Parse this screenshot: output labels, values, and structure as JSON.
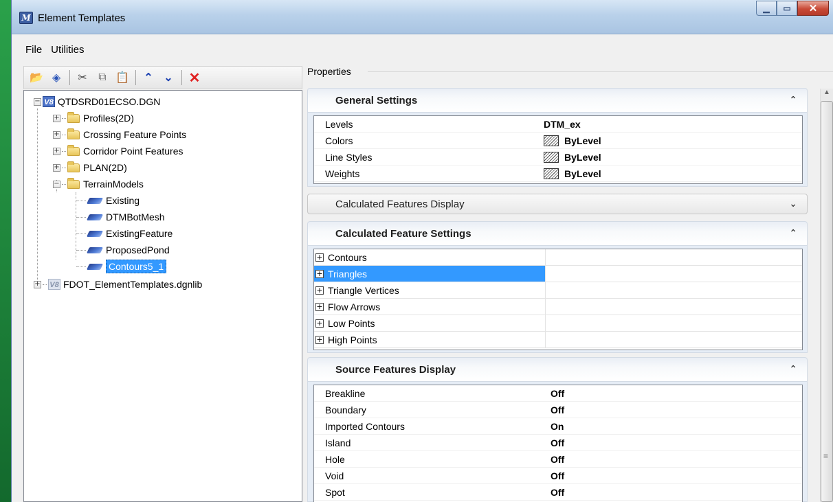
{
  "window": {
    "title": "Element Templates",
    "app_icon": "microstation-icon",
    "controls": {
      "minimize": "minimize-icon",
      "maximize": "maximize-icon",
      "close": "close-icon"
    }
  },
  "menu": [
    "File",
    "Utilities"
  ],
  "toolbar": {
    "buttons": [
      "open-folder-icon",
      "new-template-icon",
      "cut-icon",
      "copy-icon",
      "paste-icon",
      "move-up-icon",
      "move-down-icon",
      "delete-icon"
    ]
  },
  "tree": {
    "root": "QTDSRD01ECSO.DGN",
    "folders": [
      "Profiles(2D)",
      "Crossing Feature Points",
      "Corridor Point Features",
      "PLAN(2D)",
      "TerrainModels"
    ],
    "terrain_items": [
      "Existing",
      "DTMBotMesh",
      "ExistingFeature",
      "ProposedPond",
      "Contours5_1"
    ],
    "selected": "Contours5_1",
    "library": "FDOT_ElementTemplates.dgnlib"
  },
  "properties": {
    "label": "Properties",
    "general": {
      "title": "General Settings",
      "rows": [
        {
          "label": "Levels",
          "value": "DTM_ex"
        },
        {
          "label": "Colors",
          "value": "ByLevel"
        },
        {
          "label": "Line Styles",
          "value": "ByLevel"
        },
        {
          "label": "Weights",
          "value": "ByLevel"
        }
      ]
    },
    "calc_display": {
      "title": "Calculated Features Display"
    },
    "calc_settings": {
      "title": "Calculated Feature Settings",
      "rows": [
        "Contours",
        "Triangles",
        "Triangle Vertices",
        "Flow Arrows",
        "Low Points",
        "High Points"
      ],
      "selected": "Triangles"
    },
    "source": {
      "title": "Source Features Display",
      "rows": [
        {
          "label": "Breakline",
          "value": "Off"
        },
        {
          "label": "Boundary",
          "value": "Off"
        },
        {
          "label": "Imported Contours",
          "value": "On"
        },
        {
          "label": "Island",
          "value": "Off"
        },
        {
          "label": "Hole",
          "value": "Off"
        },
        {
          "label": "Void",
          "value": "Off"
        },
        {
          "label": "Spot",
          "value": "Off"
        }
      ]
    }
  }
}
